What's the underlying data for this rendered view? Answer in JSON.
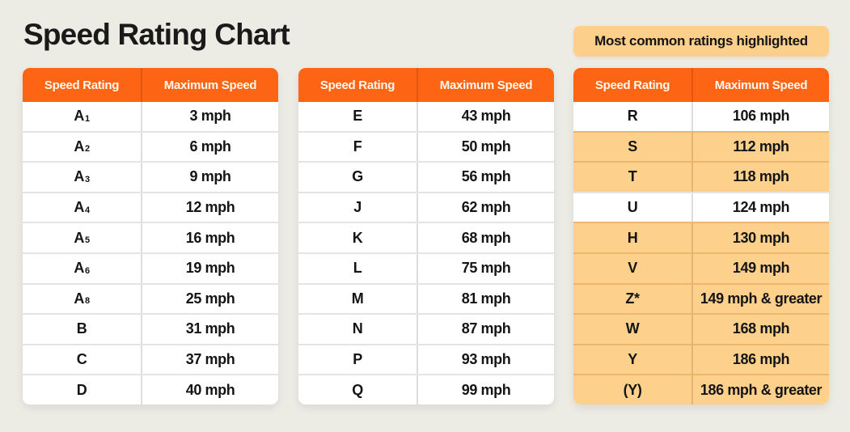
{
  "title": "Speed Rating Chart",
  "legend": "Most common ratings highlighted",
  "colors": {
    "header": "#fd6414",
    "highlight": "#fdd08b",
    "background": "#ecebe4"
  },
  "headers": {
    "rating": "Speed Rating",
    "speed": "Maximum Speed"
  },
  "tables": [
    {
      "rows": [
        {
          "rating": "A",
          "sub": "1",
          "speed": "3 mph",
          "highlighted": false
        },
        {
          "rating": "A",
          "sub": "2",
          "speed": "6 mph",
          "highlighted": false
        },
        {
          "rating": "A",
          "sub": "3",
          "speed": "9 mph",
          "highlighted": false
        },
        {
          "rating": "A",
          "sub": "4",
          "speed": "12 mph",
          "highlighted": false
        },
        {
          "rating": "A",
          "sub": "5",
          "speed": "16 mph",
          "highlighted": false
        },
        {
          "rating": "A",
          "sub": "6",
          "speed": "19 mph",
          "highlighted": false
        },
        {
          "rating": "A",
          "sub": "8",
          "speed": "25 mph",
          "highlighted": false
        },
        {
          "rating": "B",
          "sub": "",
          "speed": "31 mph",
          "highlighted": false
        },
        {
          "rating": "C",
          "sub": "",
          "speed": "37 mph",
          "highlighted": false
        },
        {
          "rating": "D",
          "sub": "",
          "speed": "40 mph",
          "highlighted": false
        }
      ]
    },
    {
      "rows": [
        {
          "rating": "E",
          "sub": "",
          "speed": "43 mph",
          "highlighted": false
        },
        {
          "rating": "F",
          "sub": "",
          "speed": "50 mph",
          "highlighted": false
        },
        {
          "rating": "G",
          "sub": "",
          "speed": "56 mph",
          "highlighted": false
        },
        {
          "rating": "J",
          "sub": "",
          "speed": "62 mph",
          "highlighted": false
        },
        {
          "rating": "K",
          "sub": "",
          "speed": "68 mph",
          "highlighted": false
        },
        {
          "rating": "L",
          "sub": "",
          "speed": "75 mph",
          "highlighted": false
        },
        {
          "rating": "M",
          "sub": "",
          "speed": "81 mph",
          "highlighted": false
        },
        {
          "rating": "N",
          "sub": "",
          "speed": "87 mph",
          "highlighted": false
        },
        {
          "rating": "P",
          "sub": "",
          "speed": "93 mph",
          "highlighted": false
        },
        {
          "rating": "Q",
          "sub": "",
          "speed": "99 mph",
          "highlighted": false
        }
      ]
    },
    {
      "rows": [
        {
          "rating": "R",
          "sub": "",
          "speed": "106 mph",
          "highlighted": false
        },
        {
          "rating": "S",
          "sub": "",
          "speed": "112 mph",
          "highlighted": true
        },
        {
          "rating": "T",
          "sub": "",
          "speed": "118 mph",
          "highlighted": true
        },
        {
          "rating": "U",
          "sub": "",
          "speed": "124 mph",
          "highlighted": false
        },
        {
          "rating": "H",
          "sub": "",
          "speed": "130 mph",
          "highlighted": true
        },
        {
          "rating": "V",
          "sub": "",
          "speed": "149 mph",
          "highlighted": true
        },
        {
          "rating": "Z*",
          "sub": "",
          "speed": "149 mph & greater",
          "highlighted": true
        },
        {
          "rating": "W",
          "sub": "",
          "speed": "168 mph",
          "highlighted": true
        },
        {
          "rating": "Y",
          "sub": "",
          "speed": "186 mph",
          "highlighted": true
        },
        {
          "rating": "(Y)",
          "sub": "",
          "speed": "186 mph & greater",
          "highlighted": true
        }
      ]
    }
  ]
}
